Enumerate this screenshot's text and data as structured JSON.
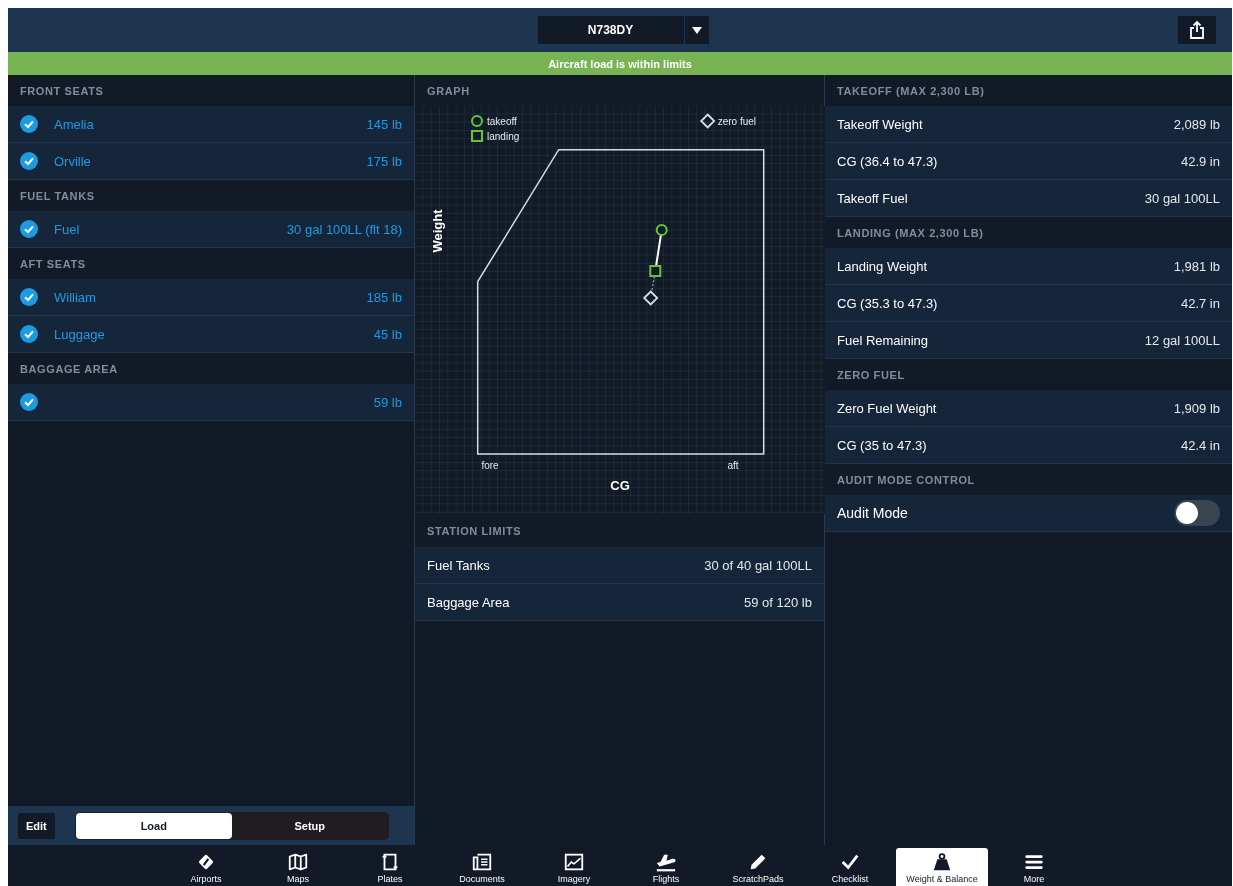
{
  "header": {
    "aircraft": "N738DY"
  },
  "status_banner": {
    "text": "Aircraft load is within limits",
    "within_limits": true
  },
  "load_panel": {
    "sections": [
      {
        "title": "FRONT SEATS",
        "items": [
          {
            "name": "Amelia",
            "value": "145 lb",
            "checked": true
          },
          {
            "name": "Orville",
            "value": "175 lb",
            "checked": true
          }
        ]
      },
      {
        "title": "FUEL TANKS",
        "items": [
          {
            "name": "Fuel",
            "value": "30 gal 100LL (flt 18)",
            "checked": true
          }
        ]
      },
      {
        "title": "AFT SEATS",
        "items": [
          {
            "name": "William",
            "value": "185 lb",
            "checked": true
          },
          {
            "name": "Luggage",
            "value": "45 lb",
            "checked": true
          }
        ]
      },
      {
        "title": "BAGGAGE AREA",
        "items": [
          {
            "value": "59 lb",
            "checked": true
          }
        ]
      }
    ]
  },
  "mode_bar": {
    "edit": "Edit",
    "options": [
      {
        "label": "Load",
        "selected": true
      },
      {
        "label": "Setup",
        "selected": false
      }
    ]
  },
  "graph": {
    "title": "GRAPH",
    "legend": [
      {
        "label": "takeoff",
        "kind": "circle"
      },
      {
        "label": "landing",
        "kind": "square"
      },
      {
        "label": "zero fuel",
        "kind": "diamond"
      }
    ],
    "ylabel": "Weight",
    "xlabel": "CG",
    "x_ends": [
      "fore",
      "aft"
    ]
  },
  "station_limits": {
    "title": "STATION LIMITS",
    "rows": [
      {
        "label": "Fuel Tanks",
        "value": "30 of 40 gal 100LL"
      },
      {
        "label": "Baggage Area",
        "value": "59 of 120 lb"
      }
    ]
  },
  "results": {
    "sections": [
      {
        "title": "TAKEOFF (MAX 2,300 LB)",
        "rows": [
          {
            "label": "Takeoff Weight",
            "value": "2,089 lb"
          },
          {
            "label": "CG (36.4 to 47.3)",
            "value": "42.9 in"
          },
          {
            "label": "Takeoff Fuel",
            "value": "30 gal 100LL"
          }
        ]
      },
      {
        "title": "LANDING (MAX 2,300 LB)",
        "rows": [
          {
            "label": "Landing Weight",
            "value": "1,981 lb"
          },
          {
            "label": "CG (35.3 to 47.3)",
            "value": "42.7 in"
          },
          {
            "label": "Fuel Remaining",
            "value": "12 gal 100LL"
          }
        ]
      },
      {
        "title": "ZERO FUEL",
        "rows": [
          {
            "label": "Zero Fuel Weight",
            "value": "1,909 lb"
          },
          {
            "label": "CG (35 to 47.3)",
            "value": "42.4 in"
          }
        ]
      }
    ]
  },
  "audit": {
    "title": "AUDIT MODE CONTROL",
    "label": "Audit Mode",
    "on": false
  },
  "tab_bar": [
    {
      "label": "Airports",
      "selected": false
    },
    {
      "label": "Maps",
      "selected": false
    },
    {
      "label": "Plates",
      "selected": false
    },
    {
      "label": "Documents",
      "selected": false
    },
    {
      "label": "Imagery",
      "selected": false
    },
    {
      "label": "Flights",
      "selected": false
    },
    {
      "label": "ScratchPads",
      "selected": false
    },
    {
      "label": "Checklist",
      "selected": false
    },
    {
      "label": "Weight & Balance",
      "selected": true
    },
    {
      "label": "More",
      "selected": false
    }
  ]
}
